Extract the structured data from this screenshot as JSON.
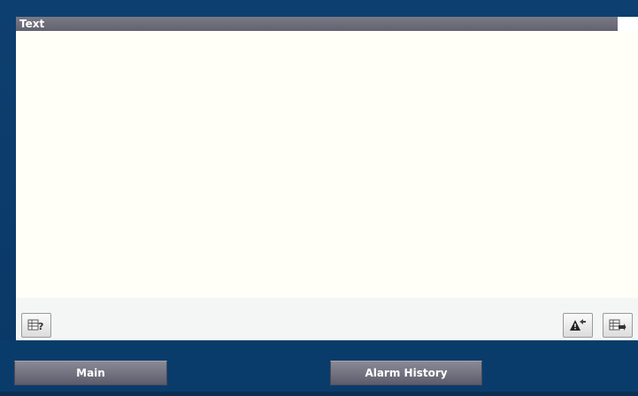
{
  "alarm_table": {
    "column_header": "Text",
    "rows": []
  },
  "toolbar": {
    "left_button_icon": "table-help-icon",
    "right_buttons": [
      {
        "icon": "acknowledge-alarm-icon"
      },
      {
        "icon": "table-edit-icon"
      }
    ]
  },
  "nav": {
    "main_label": "Main",
    "alarm_history_label": "Alarm History"
  },
  "colors": {
    "background": "#0b3b6a",
    "header": "#6e6e7a",
    "table_bg": "#fffff8"
  }
}
